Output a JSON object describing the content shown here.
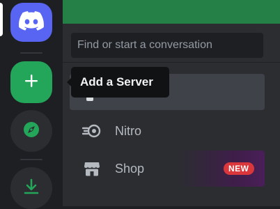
{
  "server_rail": {
    "home": {
      "icon": "discord-logo-icon"
    },
    "add_server": {
      "icon": "plus-icon"
    },
    "explore": {
      "icon": "compass-icon"
    },
    "download": {
      "icon": "download-icon"
    }
  },
  "tooltip": {
    "text": "Add a Server"
  },
  "search": {
    "placeholder": "Find or start a conversation"
  },
  "nav": [
    {
      "label": "",
      "icon": "friends-icon",
      "selected": true
    },
    {
      "label": "Nitro",
      "icon": "nitro-icon"
    },
    {
      "label": "Shop",
      "icon": "shop-icon",
      "badge": "NEW"
    }
  ],
  "colors": {
    "blurple": "#5865f2",
    "green": "#23a55a",
    "top_banner": "#248046",
    "badge_red": "#da373c",
    "sidebar": "#2b2d31",
    "rail": "#1e1f22",
    "tooltip_bg": "#111214"
  }
}
